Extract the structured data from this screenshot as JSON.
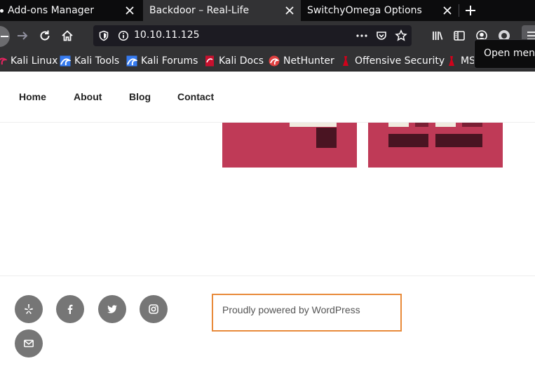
{
  "tabs": [
    {
      "label": "Add-ons Manager",
      "active": false
    },
    {
      "label": "Backdoor – Real-Life",
      "active": true
    },
    {
      "label": "SwitchyOmega Options",
      "active": false
    }
  ],
  "address_bar": {
    "url": "10.10.11.125"
  },
  "bookmarks": [
    {
      "label": "Kali Linux",
      "icon": "kali-dragon-icon"
    },
    {
      "label": "Kali Tools",
      "icon": "kali-tools-icon"
    },
    {
      "label": "Kali Forums",
      "icon": "kali-forums-icon"
    },
    {
      "label": "Kali Docs",
      "icon": "kali-docs-icon"
    },
    {
      "label": "NetHunter",
      "icon": "nethunter-icon"
    },
    {
      "label": "Offensive Security",
      "icon": "offsec-icon"
    },
    {
      "label": "MSFU",
      "icon": "msfu-icon"
    }
  ],
  "tooltip": {
    "text": "Open menu"
  },
  "site_nav": {
    "items": [
      {
        "label": "Home"
      },
      {
        "label": "About"
      },
      {
        "label": "Blog"
      },
      {
        "label": "Contact"
      }
    ]
  },
  "footer": {
    "social": [
      {
        "name": "yelp-icon"
      },
      {
        "name": "facebook-icon"
      },
      {
        "name": "twitter-icon"
      },
      {
        "name": "instagram-icon"
      },
      {
        "name": "email-icon"
      }
    ],
    "powered_by": "Proudly powered by WordPress"
  },
  "colors": {
    "browser_dark": "#0c0c0d",
    "toolbar": "#323234",
    "thumb_red": "#bf3a57",
    "thumb_dark": "#4a1422",
    "focus_orange": "#e88a3a",
    "social_gray": "#767676"
  }
}
